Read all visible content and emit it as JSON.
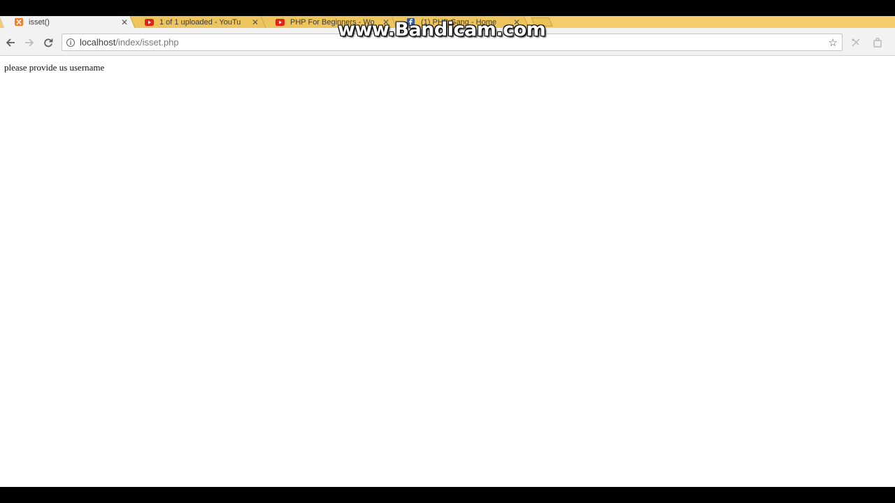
{
  "browser": {
    "tabs": [
      {
        "title": "isset()",
        "favicon": "xampp-icon",
        "active": true
      },
      {
        "title": "1 of 1 uploaded - YouTu",
        "favicon": "youtube-icon",
        "active": false
      },
      {
        "title": "PHP For Beginners - Wo",
        "favicon": "youtube-icon",
        "active": false
      },
      {
        "title": "(1) PHP Gang - Home",
        "favicon": "facebook-icon",
        "active": false
      }
    ],
    "close_glyph": "✕",
    "address": {
      "host": "localhost",
      "path": "/index/isset.php"
    }
  },
  "page": {
    "message": "please provide us username"
  },
  "watermark": "www.Bandicam.com",
  "colors": {
    "tabstrip": "#f4cd6a",
    "youtube": "#e62117",
    "xampp": "#fb7a24",
    "facebook": "#3b5998"
  }
}
